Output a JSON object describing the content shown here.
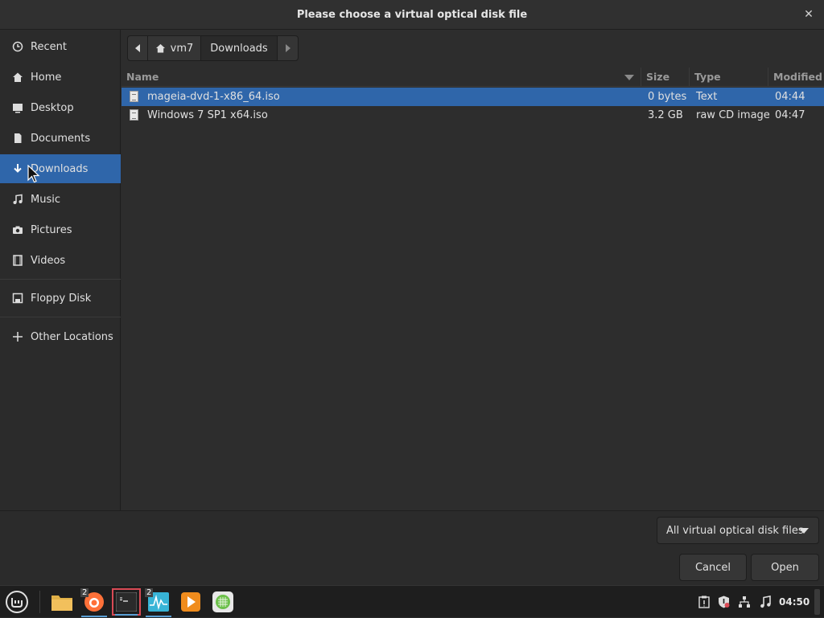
{
  "dialog": {
    "title": "Please choose a virtual optical disk file",
    "close_glyph": "✕"
  },
  "sidebar": {
    "items": [
      {
        "label": "Recent",
        "icon": "clock-icon"
      },
      {
        "label": "Home",
        "icon": "home-icon"
      },
      {
        "label": "Desktop",
        "icon": "desktop-icon"
      },
      {
        "label": "Documents",
        "icon": "document-icon"
      },
      {
        "label": "Downloads",
        "icon": "download-icon",
        "active": true
      },
      {
        "label": "Music",
        "icon": "music-icon"
      },
      {
        "label": "Pictures",
        "icon": "camera-icon"
      },
      {
        "label": "Videos",
        "icon": "film-icon"
      },
      {
        "label": "Floppy Disk",
        "icon": "floppy-icon"
      },
      {
        "label": "Other Locations",
        "icon": "plus-icon"
      }
    ]
  },
  "pathbar": {
    "home_label": "vm7",
    "current_label": "Downloads"
  },
  "columns": {
    "name": "Name",
    "size": "Size",
    "type": "Type",
    "modified": "Modified"
  },
  "files": [
    {
      "name": "mageia-dvd-1-x86_64.iso",
      "size": "0 bytes",
      "type": "Text",
      "modified": "04:44",
      "selected": true
    },
    {
      "name": "Windows 7 SP1 x64.iso",
      "size": "3.2 GB",
      "type": "raw CD image",
      "modified": "04:47",
      "selected": false
    }
  ],
  "filter": {
    "label": "All virtual optical disk files"
  },
  "buttons": {
    "cancel": "Cancel",
    "open": "Open"
  },
  "taskbar": {
    "clock": "04:50",
    "badges": {
      "firefox": "2",
      "monitor": "2"
    }
  },
  "colors": {
    "selection": "#2f66aa",
    "accent": "#5a9fd4"
  }
}
